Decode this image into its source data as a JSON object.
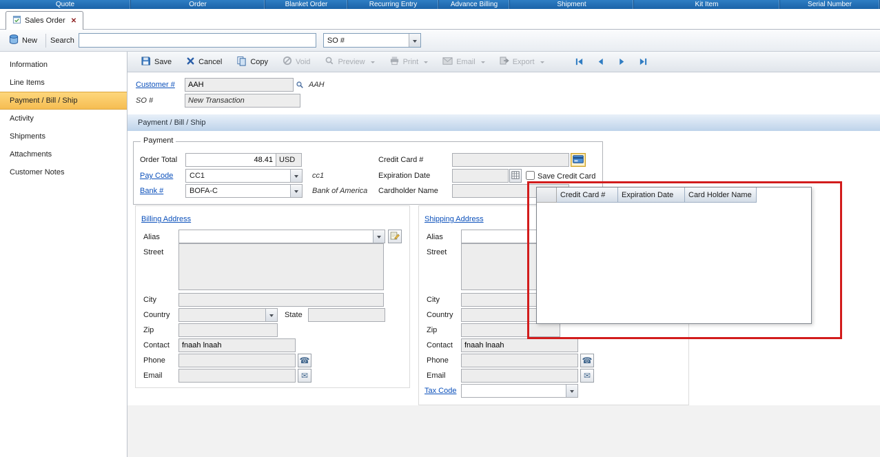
{
  "ribbon": {
    "items": [
      "Quote",
      "Order",
      "Blanket Order",
      "Recurring Entry",
      "Advance Billing",
      "Shipment",
      "Kit Item",
      "Serial Number"
    ]
  },
  "tab": {
    "label": "Sales Order"
  },
  "quickbar": {
    "new_label": "New",
    "search_label": "Search",
    "search_value": "",
    "field_selector_value": "SO #"
  },
  "sidebar": {
    "items": [
      "Information",
      "Line Items",
      "Payment / Bill / Ship",
      "Activity",
      "Shipments",
      "Attachments",
      "Customer Notes"
    ],
    "active": "Payment / Bill / Ship"
  },
  "toolbar": {
    "save": "Save",
    "cancel": "Cancel",
    "copy": "Copy",
    "void": "Void",
    "preview": "Preview",
    "print": "Print",
    "email": "Email",
    "export": "Export"
  },
  "header_fields": {
    "customer_label": "Customer #",
    "customer_number": "AAH",
    "customer_name": "AAH",
    "so_label": "SO #",
    "so_value": "New Transaction"
  },
  "section": {
    "title": "Payment / Bill / Ship"
  },
  "payment": {
    "group_label": "Payment",
    "order_total_label": "Order Total",
    "order_total_value": "48.41",
    "currency": "USD",
    "pay_code_label": "Pay Code",
    "pay_code_value": "CC1",
    "pay_code_desc": "cc1",
    "bank_label": "Bank #",
    "bank_value": "BOFA-C",
    "bank_desc": "Bank of America",
    "credit_card_label": "Credit Card #",
    "credit_card_value": "",
    "expiration_label": "Expiration Date",
    "expiration_value": "",
    "save_card_label": "Save Credit Card",
    "save_card_checked": false,
    "cardholder_label": "Cardholder Name",
    "cardholder_value": ""
  },
  "card_grid": {
    "columns": [
      "Credit Card #",
      "Expiration Date",
      "Card Holder Name"
    ],
    "rows": []
  },
  "billing": {
    "title": "Billing Address",
    "alias_label": "Alias",
    "alias_value": "",
    "street_label": "Street",
    "street_value": "",
    "city_label": "City",
    "city_value": "",
    "country_label": "Country",
    "country_value": "",
    "state_label": "State",
    "state_value": "",
    "zip_label": "Zip",
    "zip_value": "",
    "contact_label": "Contact",
    "contact_value": "fnaah lnaah",
    "phone_label": "Phone",
    "phone_value": "",
    "email_label": "Email",
    "email_value": ""
  },
  "shipping": {
    "title": "Shipping Address",
    "alias_label": "Alias",
    "alias_value": "",
    "street_label": "Street",
    "street_value": "",
    "city_label": "City",
    "city_value": "",
    "country_label": "Country",
    "country_value": "",
    "zip_label": "Zip",
    "zip_value": "",
    "contact_label": "Contact",
    "contact_value": "fnaah lnaah",
    "phone_label": "Phone",
    "phone_value": "",
    "email_label": "Email",
    "email_value": "",
    "tax_code_label": "Tax Code",
    "tax_code_value": ""
  },
  "colors": {
    "ribbon_blue": "#2172b7",
    "sidebar_active": "#f9c75d",
    "link_blue": "#0b50bb",
    "annotation_red": "#d21c1c",
    "section_bar": "#c3d7ec"
  },
  "icons": {
    "close": "✕",
    "phone": "☎",
    "envelope": "✉"
  }
}
